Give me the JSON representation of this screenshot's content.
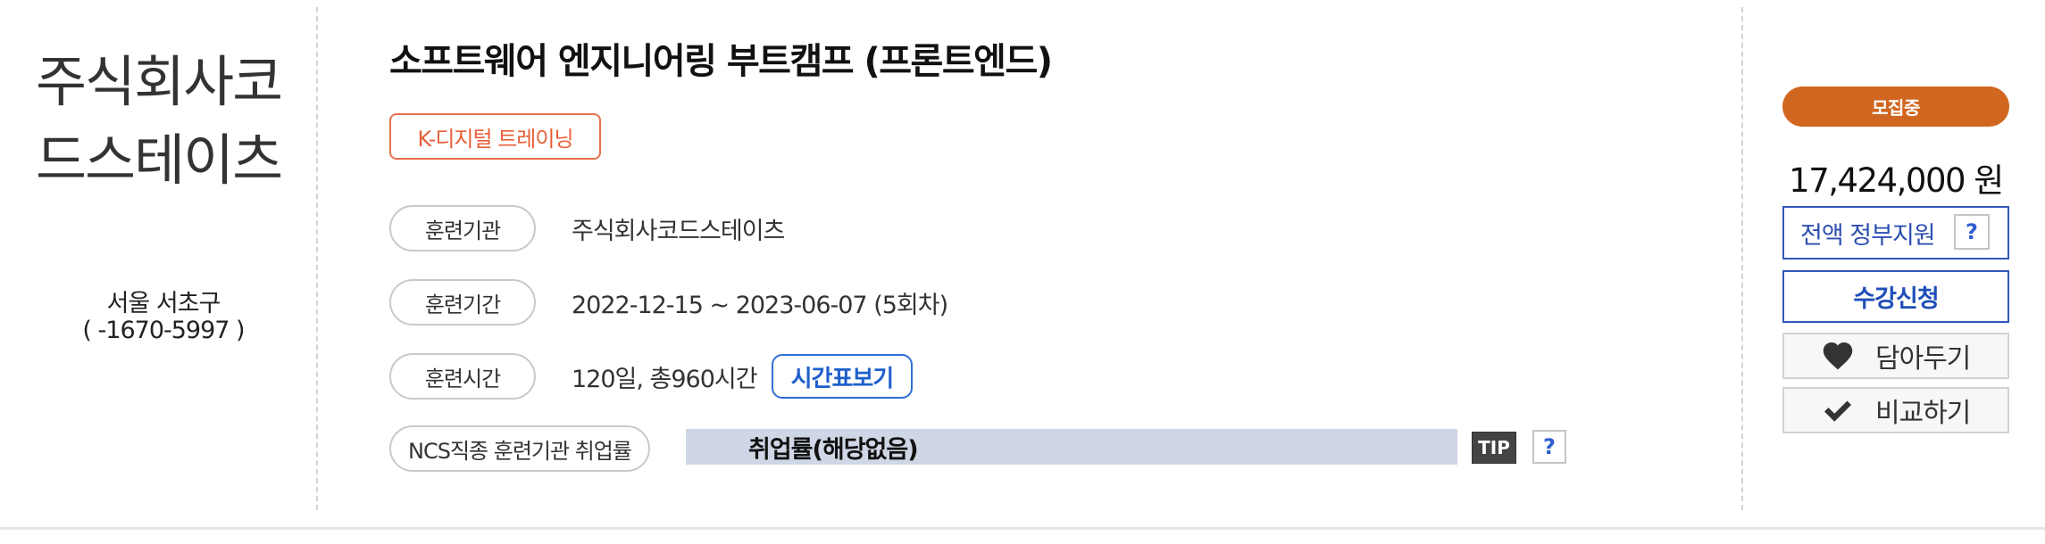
{
  "institution": {
    "name": "주식회사코드스테이츠",
    "location": "서울 서초구",
    "phone": "( -1670-5997 )"
  },
  "course": {
    "title": "소프트웨어 엔지니어링 부트캠프 (프론트엔드)",
    "program_badge": "K-디지털 트레이닝",
    "rows": [
      {
        "label": "훈련기관",
        "value": "주식회사코드스테이츠"
      },
      {
        "label": "훈련기간",
        "value": "2022-12-15 ~ 2023-06-07 (5회차)"
      },
      {
        "label": "훈련시간",
        "value": "120일, 총960시간",
        "button": "시간표보기"
      }
    ],
    "employment": {
      "label": "NCS직종 훈련기관 취업률",
      "value": "취업률(해당없음)",
      "tip": "TIP",
      "help": "?"
    }
  },
  "sidebar": {
    "status": "모집중",
    "price": "17,424,000 원",
    "subsidy": "전액 정부지원",
    "subsidy_help": "?",
    "apply": "수강신청",
    "save": "담아두기",
    "compare": "비교하기"
  },
  "colors": {
    "status": "#d0661f",
    "accent_blue": "#3256b8",
    "badge_orange": "#e8704a",
    "employment_bar": "#cfd6e5"
  },
  "icons": {
    "save": "heart-icon",
    "compare": "check-icon"
  }
}
